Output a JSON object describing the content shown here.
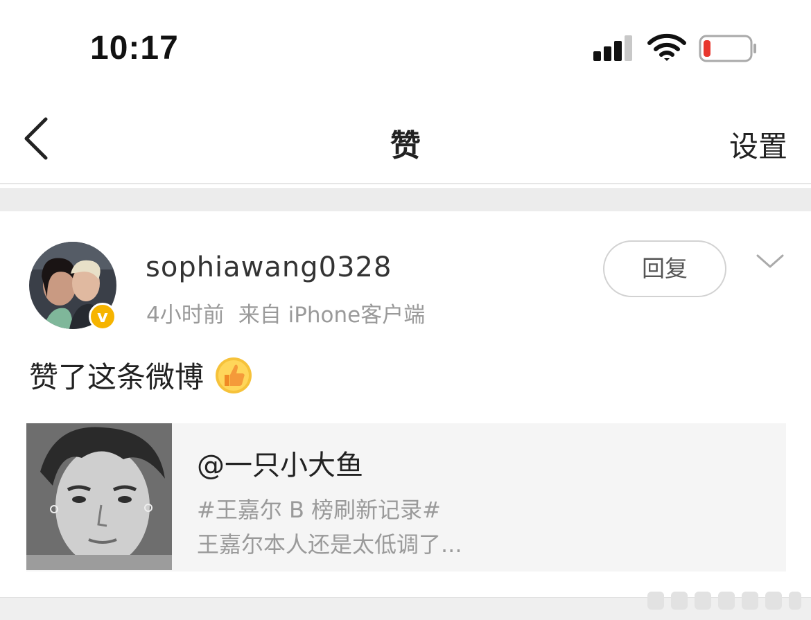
{
  "status_bar": {
    "time": "10:17",
    "signal_icon": "cellular-signal-icon",
    "wifi_icon": "wifi-icon",
    "battery_icon": "battery-low-icon",
    "battery_level": 0.08,
    "battery_color": "#e8372e"
  },
  "nav": {
    "back_icon": "chevron-left-icon",
    "title": "赞",
    "settings_label": "设置"
  },
  "post": {
    "username": "sophiawang0328",
    "verified_color": "#f6b400",
    "verified_mark": "v",
    "time_ago": "4小时前",
    "source": "来自 iPhone客户端",
    "reply_label": "回复",
    "menu_icon": "chevron-down-icon",
    "like_text": "赞了这条微博",
    "like_icon": "thumbs-up-emoji-icon",
    "quoted": {
      "author": "@一只小大鱼",
      "line1": "#王嘉尔 B 榜刷新记录#",
      "line2": "王嘉尔本人还是太低调了..."
    }
  }
}
